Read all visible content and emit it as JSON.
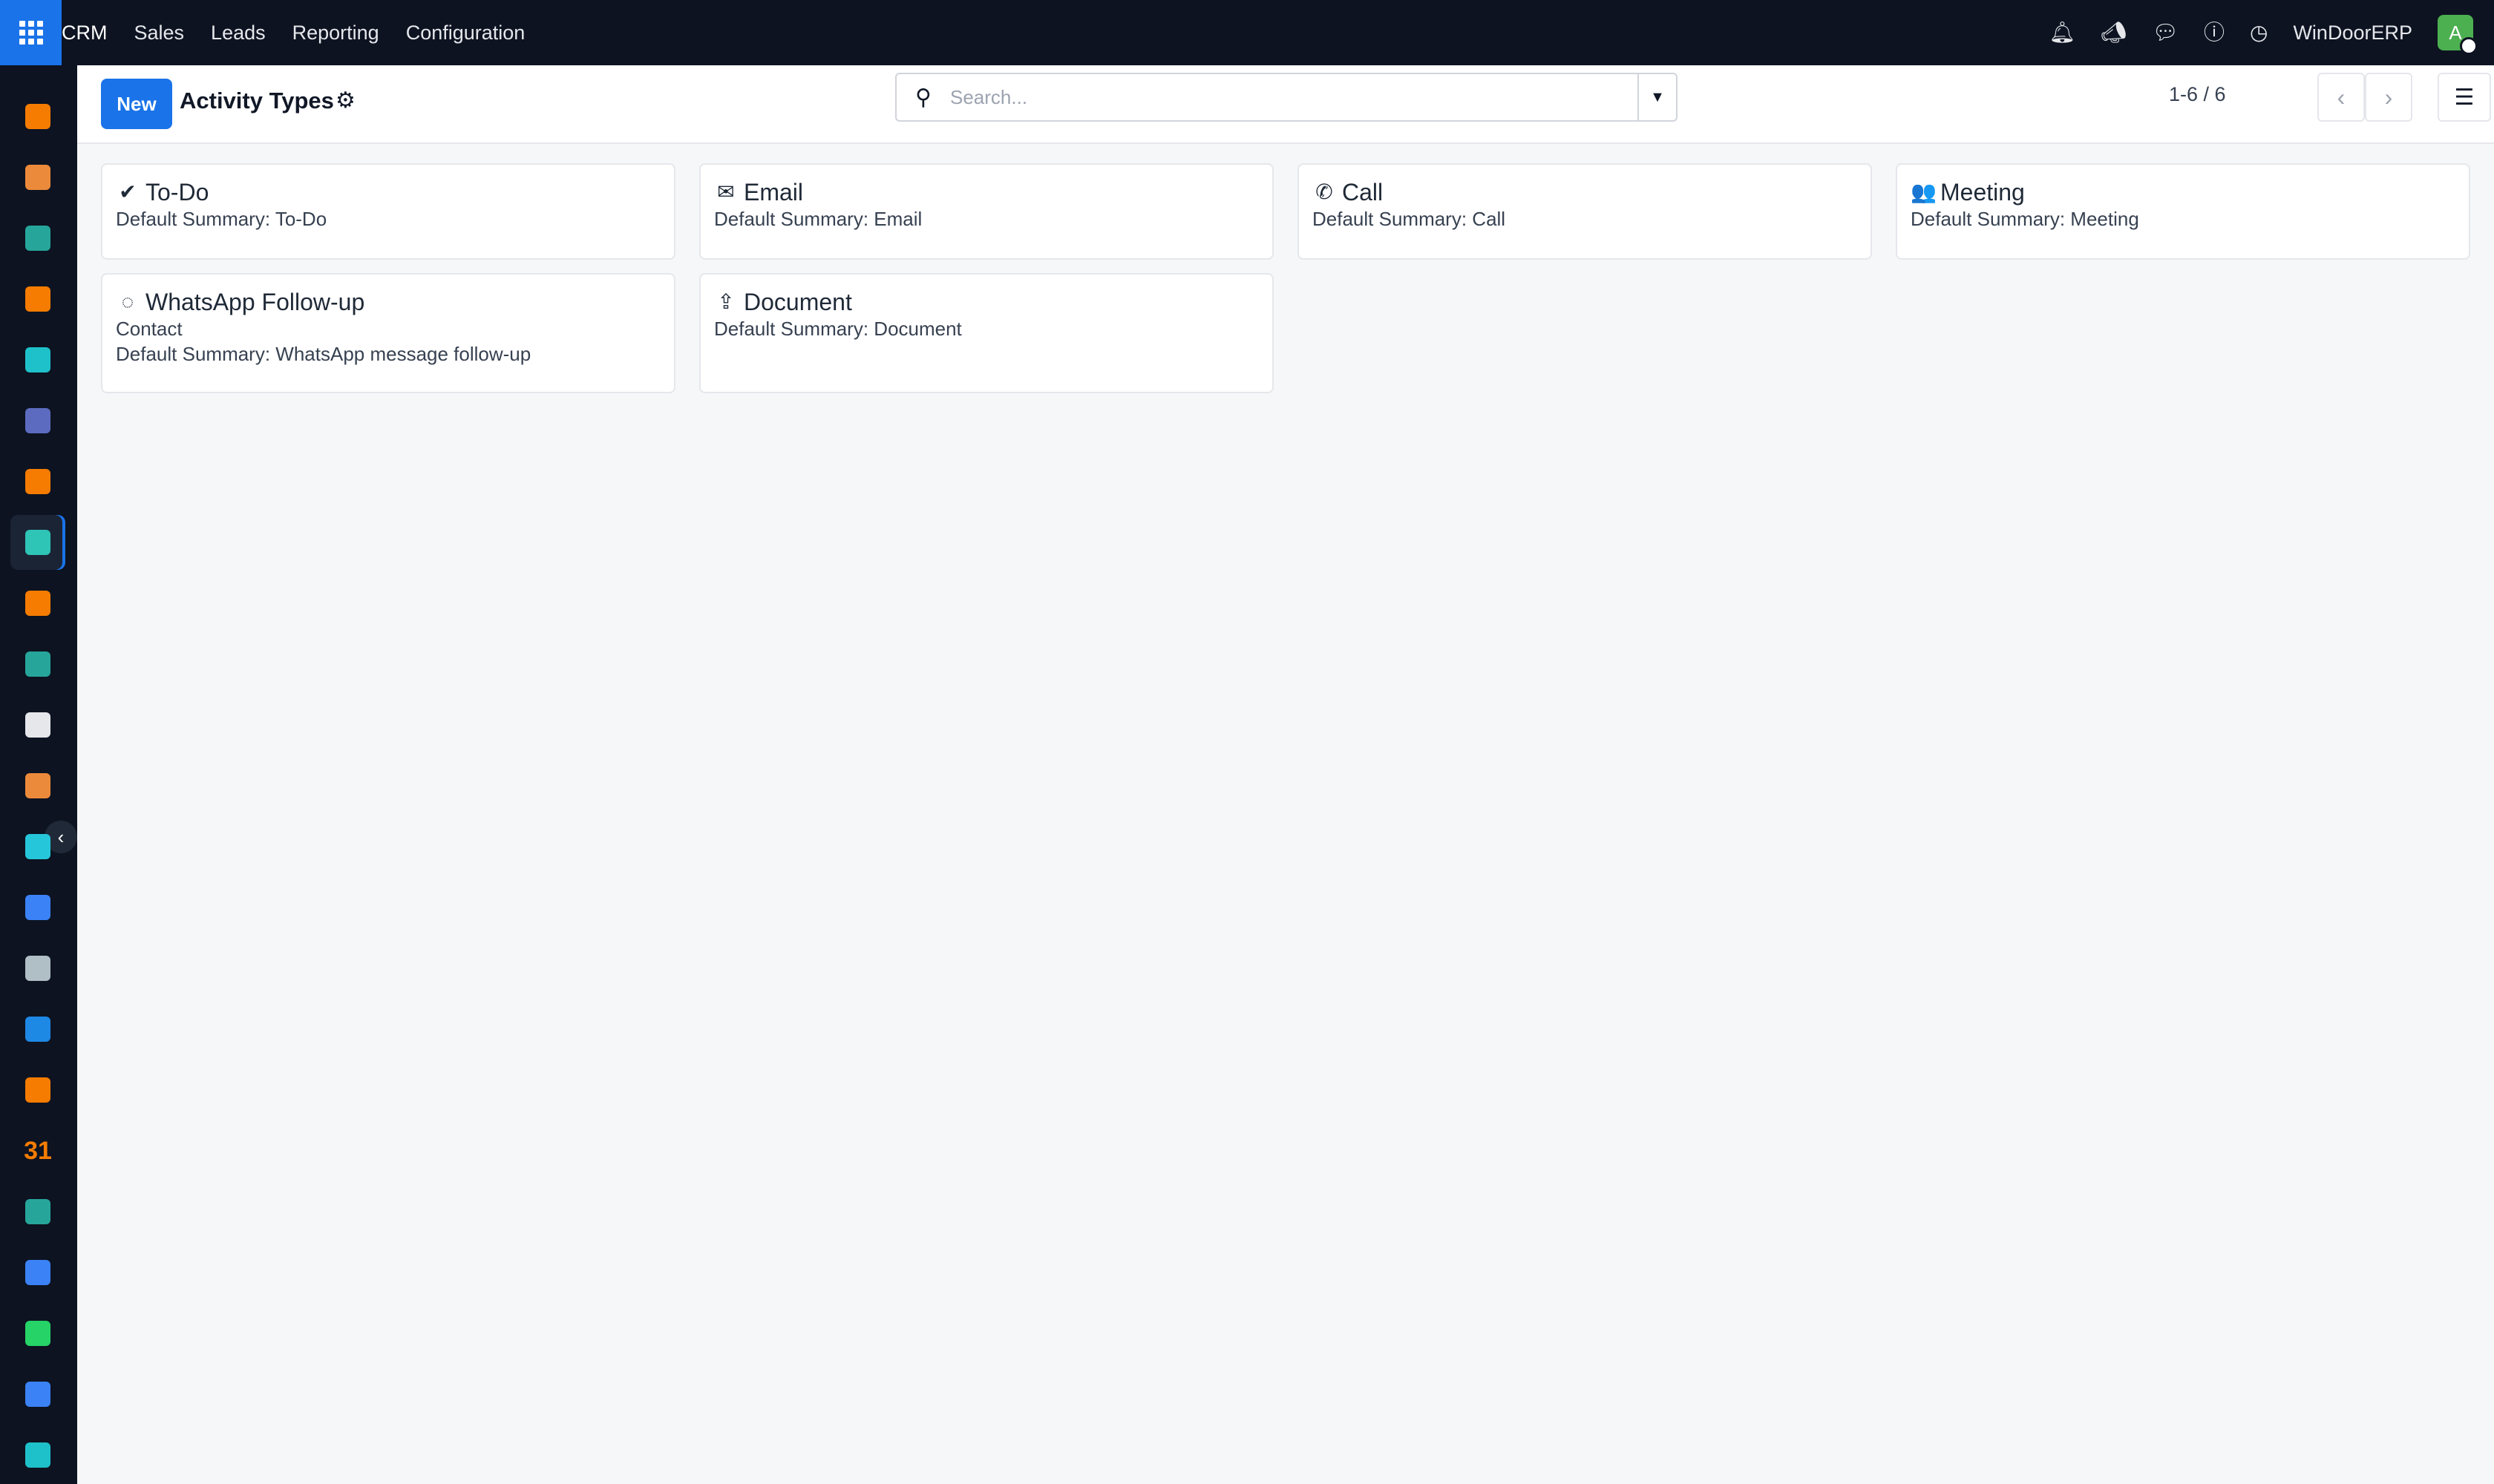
{
  "topbar": {
    "menu": [
      "CRM",
      "Sales",
      "Leads",
      "Reporting",
      "Configuration"
    ],
    "company": "WinDoorERP",
    "avatar_initial": "A",
    "icons": [
      "bell-icon",
      "megaphone-icon",
      "chat-icon",
      "help-icon",
      "clock-icon"
    ]
  },
  "sidebar": {
    "apps": [
      {
        "name": "dashboard-app",
        "color": "#f57c00"
      },
      {
        "name": "studio-app",
        "color": "#ec8a3b"
      },
      {
        "name": "contacts-app",
        "color": "#26a69a"
      },
      {
        "name": "discuss-app",
        "color": "#f57c00"
      },
      {
        "name": "website-app",
        "color": "#1ec1c9"
      },
      {
        "name": "mail-app",
        "color": "#5c6bc0"
      },
      {
        "name": "livechat-app",
        "color": "#f57c00"
      },
      {
        "name": "crm-app",
        "color": "#2ec4b6"
      },
      {
        "name": "reports-app",
        "color": "#f57c00"
      },
      {
        "name": "employees-app",
        "color": "#26a69a"
      },
      {
        "name": "inventory-app",
        "color": "#e5e7eb"
      },
      {
        "name": "studio2-app",
        "color": "#ec8a3b"
      },
      {
        "name": "project-app",
        "color": "#26c6da"
      },
      {
        "name": "knowledge-app",
        "color": "#3b82f6"
      },
      {
        "name": "packages-app",
        "color": "#b0bec5"
      },
      {
        "name": "invoicing-app",
        "color": "#1e88e5"
      },
      {
        "name": "team-app",
        "color": "#f57c00"
      },
      {
        "name": "calendar-app",
        "color": "#f57c00"
      },
      {
        "name": "sign-app",
        "color": "#26a69a"
      },
      {
        "name": "dashboards-app",
        "color": "#3b82f6"
      },
      {
        "name": "whatsapp-app",
        "color": "#25d366"
      },
      {
        "name": "time-off-app",
        "color": "#3b82f6"
      },
      {
        "name": "website2-app",
        "color": "#1ec1c9"
      }
    ],
    "calendar_label": "31"
  },
  "control": {
    "new_label": "New",
    "title": "Activity Types",
    "search_placeholder": "Search...",
    "pager": "1-6 / 6"
  },
  "cards": [
    {
      "title": "To-Do",
      "icon": "check-icon",
      "glyph": "✔",
      "lines": [
        "Default Summary: To-Do"
      ]
    },
    {
      "title": "Email",
      "icon": "envelope-icon",
      "glyph": "✉",
      "lines": [
        "Default Summary: Email"
      ]
    },
    {
      "title": "Call",
      "icon": "phone-icon",
      "glyph": "✆",
      "lines": [
        "Default Summary: Call"
      ]
    },
    {
      "title": "Meeting",
      "icon": "users-icon",
      "glyph": "👥",
      "lines": [
        "Default Summary: Meeting"
      ]
    },
    {
      "title": "WhatsApp Follow-up",
      "icon": "whatsapp-icon",
      "glyph": "◌",
      "lines": [
        "Contact",
        "Default Summary: WhatsApp message follow-up"
      ]
    },
    {
      "title": "Document",
      "icon": "upload-icon",
      "glyph": "⇪",
      "lines": [
        "Default Summary: Document"
      ]
    }
  ]
}
